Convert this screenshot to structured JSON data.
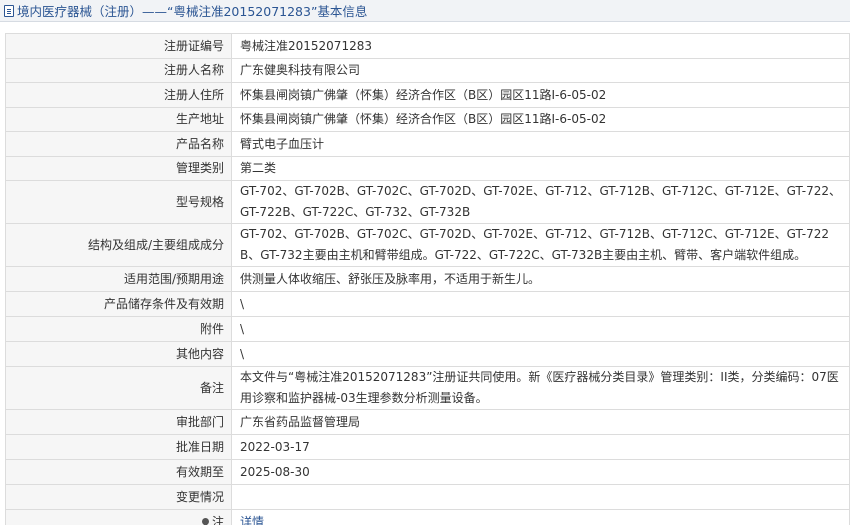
{
  "header": {
    "title": "境内医疗器械（注册）——“粤械注准20152071283”基本信息",
    "icon": "document-icon"
  },
  "rows": [
    {
      "label": "注册证编号",
      "value": "粤械注准20152071283"
    },
    {
      "label": "注册人名称",
      "value": "广东健奥科技有限公司"
    },
    {
      "label": "注册人住所",
      "value": "怀集县闸岗镇广佛肇（怀集）经济合作区（B区）园区11路I-6-05-02"
    },
    {
      "label": "生产地址",
      "value": "怀集县闸岗镇广佛肇（怀集）经济合作区（B区）园区11路I-6-05-02"
    },
    {
      "label": "产品名称",
      "value": "臂式电子血压计"
    },
    {
      "label": "管理类别",
      "value": "第二类"
    },
    {
      "label": "型号规格",
      "value": "GT-702、GT-702B、GT-702C、GT-702D、GT-702E、GT-712、GT-712B、GT-712C、GT-712E、GT-722、GT-722B、GT-722C、GT-732、GT-732B"
    },
    {
      "label": "结构及组成/主要组成成分",
      "value": "GT-702、GT-702B、GT-702C、GT-702D、GT-702E、GT-712、GT-712B、GT-712C、GT-712E、GT-722B、GT-732主要由主机和臂带组成。GT-722、GT-722C、GT-732B主要由主机、臂带、客户端软件组成。"
    },
    {
      "label": "适用范围/预期用途",
      "value": "供测量人体收缩压、舒张压及脉率用，不适用于新生儿。"
    },
    {
      "label": "产品储存条件及有效期",
      "value": "\\"
    },
    {
      "label": "附件",
      "value": "\\"
    },
    {
      "label": "其他内容",
      "value": "\\"
    },
    {
      "label": "备注",
      "value": "本文件与“粤械注准20152071283”注册证共同使用。新《医疗器械分类目录》管理类别：II类，分类编码：07医用诊察和监护器械-03生理参数分析测量设备。"
    },
    {
      "label": "审批部门",
      "value": "广东省药品监督管理局"
    },
    {
      "label": "批准日期",
      "value": "2022-03-17"
    },
    {
      "label": "有效期至",
      "value": "2025-08-30"
    },
    {
      "label": "变更情况",
      "value": ""
    }
  ],
  "note_row": {
    "label": "注",
    "icon": "pin-icon",
    "link_text": "详情"
  }
}
